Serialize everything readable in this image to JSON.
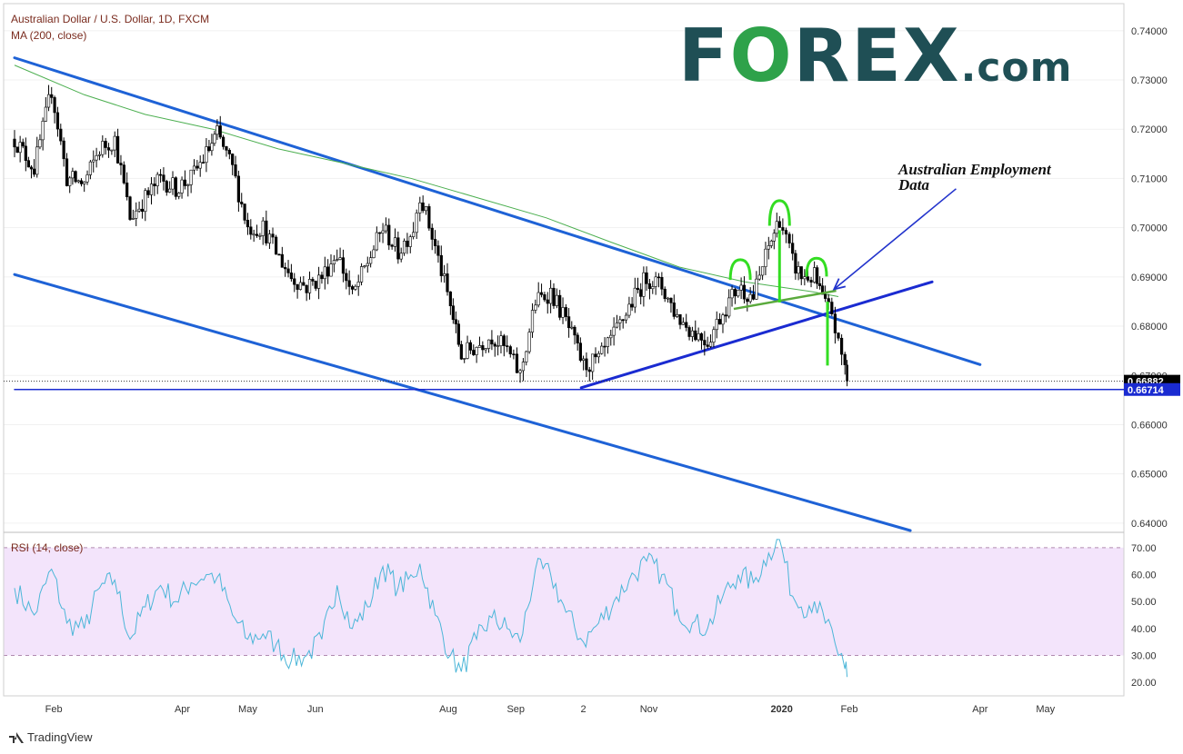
{
  "header": {
    "symbol_title": "Australian Dollar / U.S. Dollar, 1D, FXCM",
    "ma_label": "MA (200, close)",
    "rsi_label": "RSI (14, close)"
  },
  "logo": {
    "brand_left": "F",
    "brand_o": "O",
    "brand_right": "REX",
    "domain": ".com"
  },
  "annotation": {
    "line1": "Australian Employment",
    "line2": "Data"
  },
  "footer": {
    "brand": "TradingView"
  },
  "colors": {
    "candle": "#000000",
    "ma200": "#4caf50",
    "trendline": "#1e62d6",
    "support": "#1a2bd1",
    "pattern": "#33dd22",
    "rsi": "#4bb6d8",
    "rsi_band": "#f3e4fb",
    "price_box": "#1a2bd1"
  },
  "chart_data": [
    {
      "type": "candlestick",
      "title": "Australian Dollar / U.S. Dollar, 1D, FXCM",
      "ylim": [
        0.6385,
        0.7455
      ],
      "yticks": [
        0.74,
        0.73,
        0.72,
        0.71,
        0.7,
        0.69,
        0.68,
        0.67,
        0.66,
        0.65,
        0.64
      ],
      "ytick_labels": [
        "0.74000",
        "0.73000",
        "0.72000",
        "0.71000",
        "0.70000",
        "0.69000",
        "0.68000",
        "0.67000",
        "0.66000",
        "0.65000",
        "0.64000"
      ],
      "x_labels": [
        {
          "label": "Feb",
          "date": "2019-02-01"
        },
        {
          "label": "Apr",
          "date": "2019-04-01"
        },
        {
          "label": "May",
          "date": "2019-05-01"
        },
        {
          "label": "Jun",
          "date": "2019-06-01"
        },
        {
          "label": "Aug",
          "date": "2019-08-01"
        },
        {
          "label": "Sep",
          "date": "2019-09-01"
        },
        {
          "label": "2",
          "date": "2019-10-02"
        },
        {
          "label": "Nov",
          "date": "2019-11-01"
        },
        {
          "label": "2020",
          "date": "2020-01-01"
        },
        {
          "label": "Feb",
          "date": "2020-02-01"
        },
        {
          "label": "Apr",
          "date": "2020-04-01"
        },
        {
          "label": "May",
          "date": "2020-05-01"
        }
      ],
      "last_price": "0.66882",
      "support_price": "0.66714",
      "series": [
        {
          "name": "AUDUSD close",
          "kind": "close",
          "points": [
            [
              "2019-01-14",
              0.718
            ],
            [
              "2019-01-23",
              0.712
            ],
            [
              "2019-01-31",
              0.728
            ],
            [
              "2019-02-07",
              0.71
            ],
            [
              "2019-02-15",
              0.709
            ],
            [
              "2019-02-22",
              0.716
            ],
            [
              "2019-03-01",
              0.718
            ],
            [
              "2019-03-08",
              0.702
            ],
            [
              "2019-03-15",
              0.706
            ],
            [
              "2019-03-22",
              0.71
            ],
            [
              "2019-03-29",
              0.708
            ],
            [
              "2019-04-05",
              0.71
            ],
            [
              "2019-04-12",
              0.715
            ],
            [
              "2019-04-17",
              0.719
            ],
            [
              "2019-04-24",
              0.712
            ],
            [
              "2019-05-01",
              0.7
            ],
            [
              "2019-05-08",
              0.7
            ],
            [
              "2019-05-14",
              0.695
            ],
            [
              "2019-05-21",
              0.69
            ],
            [
              "2019-05-28",
              0.688
            ],
            [
              "2019-06-04",
              0.69
            ],
            [
              "2019-06-11",
              0.695
            ],
            [
              "2019-06-18",
              0.686
            ],
            [
              "2019-06-25",
              0.693
            ],
            [
              "2019-07-02",
              0.7
            ],
            [
              "2019-07-09",
              0.695
            ],
            [
              "2019-07-16",
              0.7
            ],
            [
              "2019-07-19",
              0.707
            ],
            [
              "2019-07-26",
              0.696
            ],
            [
              "2019-08-02",
              0.684
            ],
            [
              "2019-08-07",
              0.674
            ],
            [
              "2019-08-14",
              0.676
            ],
            [
              "2019-08-21",
              0.678
            ],
            [
              "2019-08-28",
              0.675
            ],
            [
              "2019-09-03",
              0.67
            ],
            [
              "2019-09-10",
              0.685
            ],
            [
              "2019-09-17",
              0.687
            ],
            [
              "2019-09-24",
              0.681
            ],
            [
              "2019-10-02",
              0.672
            ],
            [
              "2019-10-09",
              0.673
            ],
            [
              "2019-10-16",
              0.678
            ],
            [
              "2019-10-23",
              0.684
            ],
            [
              "2019-10-31",
              0.69
            ],
            [
              "2019-11-07",
              0.688
            ],
            [
              "2019-11-14",
              0.682
            ],
            [
              "2019-11-21",
              0.679
            ],
            [
              "2019-11-28",
              0.677
            ],
            [
              "2019-12-05",
              0.683
            ],
            [
              "2019-12-12",
              0.688
            ],
            [
              "2019-12-19",
              0.686
            ],
            [
              "2019-12-26",
              0.696
            ],
            [
              "2019-12-31",
              0.702
            ],
            [
              "2020-01-06",
              0.693
            ],
            [
              "2020-01-10",
              0.69
            ],
            [
              "2020-01-16",
              0.69
            ],
            [
              "2020-01-21",
              0.684
            ],
            [
              "2020-01-24",
              0.683
            ],
            [
              "2020-01-27",
              0.676
            ],
            [
              "2020-01-30",
              0.672
            ],
            [
              "2020-01-31",
              0.6688
            ]
          ]
        },
        {
          "name": "MA (200, close)",
          "points": [
            [
              "2019-01-14",
              0.733
            ],
            [
              "2019-02-15",
              0.727
            ],
            [
              "2019-03-15",
              0.723
            ],
            [
              "2019-04-15",
              0.72
            ],
            [
              "2019-05-15",
              0.716
            ],
            [
              "2019-06-15",
              0.713
            ],
            [
              "2019-07-15",
              0.71
            ],
            [
              "2019-08-15",
              0.706
            ],
            [
              "2019-09-15",
              0.702
            ],
            [
              "2019-10-15",
              0.697
            ],
            [
              "2019-11-15",
              0.692
            ],
            [
              "2019-12-15",
              0.689
            ],
            [
              "2020-01-15",
              0.687
            ],
            [
              "2020-01-27",
              0.686
            ]
          ]
        }
      ],
      "trendlines": [
        {
          "name": "upper channel",
          "from": [
            "2019-01-14",
            0.7345
          ],
          "to": [
            "2020-04-01",
            0.6722
          ]
        },
        {
          "name": "lower channel",
          "from": [
            "2019-01-14",
            0.6905
          ],
          "to": [
            "2020-02-29",
            0.6385
          ]
        },
        {
          "name": "rising support",
          "from": [
            "2019-10-01",
            0.6675
          ],
          "to": [
            "2020-03-10",
            0.689
          ]
        },
        {
          "name": "support",
          "from": [
            "2019-01-14",
            0.66714
          ],
          "to": [
            "2020-06-30",
            0.66714
          ]
        }
      ]
    },
    {
      "type": "line",
      "title": "RSI (14, close)",
      "ylim": [
        15,
        75
      ],
      "yticks": [
        70,
        60,
        50,
        40,
        30,
        20
      ],
      "ytick_labels": [
        "70.00",
        "60.00",
        "50.00",
        "40.00",
        "30.00",
        "20.00"
      ],
      "bands": [
        30,
        70
      ],
      "series": [
        {
          "name": "RSI",
          "points": [
            [
              "2019-01-14",
              55
            ],
            [
              "2019-01-23",
              45
            ],
            [
              "2019-01-31",
              62
            ],
            [
              "2019-02-07",
              42
            ],
            [
              "2019-02-15",
              40
            ],
            [
              "2019-02-22",
              55
            ],
            [
              "2019-03-01",
              58
            ],
            [
              "2019-03-08",
              36
            ],
            [
              "2019-03-15",
              48
            ],
            [
              "2019-03-22",
              56
            ],
            [
              "2019-03-29",
              50
            ],
            [
              "2019-04-05",
              57
            ],
            [
              "2019-04-12",
              60
            ],
            [
              "2019-04-17",
              59
            ],
            [
              "2019-04-24",
              45
            ],
            [
              "2019-05-01",
              36
            ],
            [
              "2019-05-08",
              38
            ],
            [
              "2019-05-14",
              34
            ],
            [
              "2019-05-21",
              28
            ],
            [
              "2019-05-28",
              30
            ],
            [
              "2019-06-04",
              36
            ],
            [
              "2019-06-11",
              56
            ],
            [
              "2019-06-18",
              40
            ],
            [
              "2019-06-25",
              48
            ],
            [
              "2019-07-02",
              63
            ],
            [
              "2019-07-09",
              55
            ],
            [
              "2019-07-16",
              59
            ],
            [
              "2019-07-19",
              64
            ],
            [
              "2019-07-26",
              45
            ],
            [
              "2019-08-02",
              30
            ],
            [
              "2019-08-07",
              24
            ],
            [
              "2019-08-14",
              36
            ],
            [
              "2019-08-21",
              44
            ],
            [
              "2019-08-28",
              40
            ],
            [
              "2019-09-03",
              35
            ],
            [
              "2019-09-10",
              62
            ],
            [
              "2019-09-17",
              60
            ],
            [
              "2019-09-24",
              46
            ],
            [
              "2019-10-02",
              35
            ],
            [
              "2019-10-09",
              42
            ],
            [
              "2019-10-16",
              50
            ],
            [
              "2019-10-23",
              58
            ],
            [
              "2019-10-31",
              65
            ],
            [
              "2019-11-07",
              60
            ],
            [
              "2019-11-14",
              47
            ],
            [
              "2019-11-21",
              42
            ],
            [
              "2019-11-28",
              40
            ],
            [
              "2019-12-05",
              52
            ],
            [
              "2019-12-12",
              60
            ],
            [
              "2019-12-19",
              57
            ],
            [
              "2019-12-26",
              68
            ],
            [
              "2019-12-31",
              73
            ],
            [
              "2020-01-06",
              52
            ],
            [
              "2020-01-10",
              48
            ],
            [
              "2020-01-16",
              50
            ],
            [
              "2020-01-21",
              42
            ],
            [
              "2020-01-24",
              40
            ],
            [
              "2020-01-27",
              30
            ],
            [
              "2020-01-30",
              25
            ],
            [
              "2020-01-31",
              22
            ]
          ]
        }
      ]
    }
  ]
}
